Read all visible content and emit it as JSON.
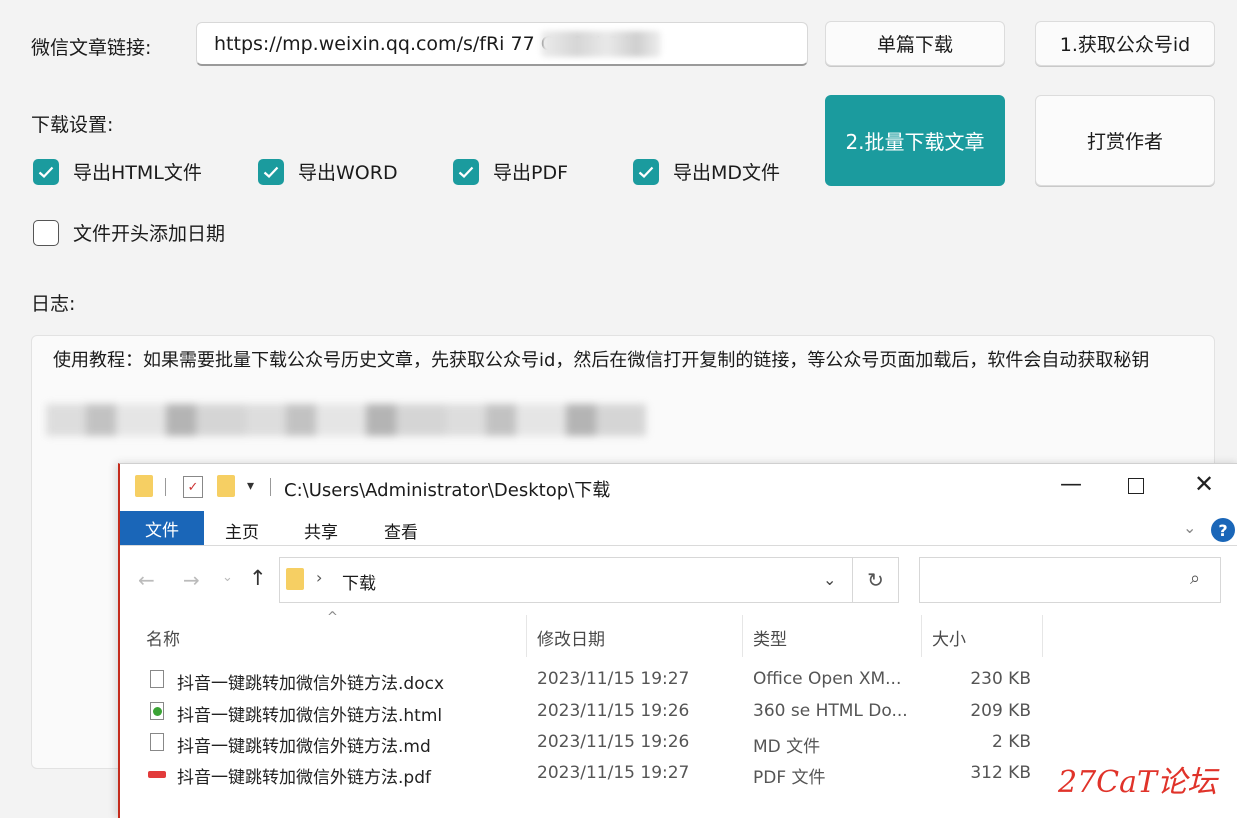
{
  "app": {
    "url_label": "微信文章链接:",
    "url_value": "https://mp.weixin.qq.com/s/fRi 77 C                e04bRA",
    "btn_single": "单篇下载",
    "btn_get_id": "1.获取公众号id",
    "btn_batch": "2.批量下载文章",
    "btn_tip": "打赏作者",
    "settings_label": "下载设置:",
    "options": [
      {
        "label": "导出HTML文件",
        "checked": true
      },
      {
        "label": "导出WORD",
        "checked": true
      },
      {
        "label": "导出PDF",
        "checked": true
      },
      {
        "label": "导出MD文件",
        "checked": true
      },
      {
        "label": "文件开头添加日期",
        "checked": false
      }
    ],
    "log_label": "日志:",
    "log_text": "使用教程：如果需要批量下载公众号历史文章，先获取公众号id，然后在微信打开复制的链接，等公众号页面加载后，软件会自动获取秘钥",
    "accent": "#1b9b9e"
  },
  "explorer": {
    "title_path": "C:\\Users\\Administrator\\Desktop\\下载",
    "tabs": [
      "文件",
      "主页",
      "共享",
      "查看"
    ],
    "breadcrumb": "下载",
    "columns": [
      "名称",
      "修改日期",
      "类型",
      "大小"
    ],
    "files": [
      {
        "name": "抖音一键跳转加微信外链方法.docx",
        "date": "2023/11/15 19:27",
        "type": "Office Open XM...",
        "size": "230 KB",
        "icon": "docx-icon"
      },
      {
        "name": "抖音一键跳转加微信外链方法.html",
        "date": "2023/11/15 19:26",
        "type": "360 se HTML Do...",
        "size": "209 KB",
        "icon": "html-icon"
      },
      {
        "name": "抖音一键跳转加微信外链方法.md",
        "date": "2023/11/15 19:26",
        "type": "MD 文件",
        "size": "2 KB",
        "icon": "md-icon"
      },
      {
        "name": "抖音一键跳转加微信外链方法.pdf",
        "date": "2023/11/15 19:27",
        "type": "PDF 文件",
        "size": "312 KB",
        "icon": "pdf-icon"
      }
    ],
    "accent": "#1a66b8"
  },
  "watermark": "27CaT论坛"
}
